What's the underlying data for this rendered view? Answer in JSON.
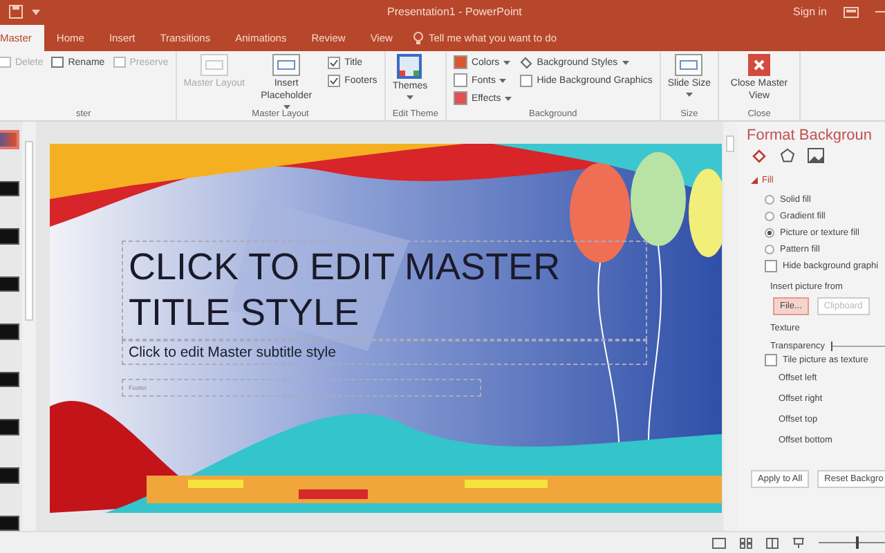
{
  "window": {
    "title": "Presentation1 - PowerPoint",
    "sign_in": "Sign in"
  },
  "tabs": [
    {
      "label": "Master",
      "selected": true
    },
    {
      "label": "Home",
      "selected": false
    },
    {
      "label": "Insert",
      "selected": false
    },
    {
      "label": "Transitions",
      "selected": false
    },
    {
      "label": "Animations",
      "selected": false
    },
    {
      "label": "Review",
      "selected": false
    },
    {
      "label": "View",
      "selected": false
    }
  ],
  "tell_me": {
    "placeholder": "Tell me what you want to do"
  },
  "ribbon": {
    "groups": [
      {
        "label": "ster",
        "items": [
          {
            "kind": "small",
            "label": "Delete",
            "disabled": true
          },
          {
            "kind": "small",
            "label": "Rename",
            "disabled": false
          },
          {
            "kind": "small",
            "label": "Preserve",
            "disabled": true
          }
        ]
      },
      {
        "label": "Master Layout",
        "items": [
          {
            "kind": "large",
            "label": "Master Layout",
            "disabled": true,
            "dropdown": false
          },
          {
            "kind": "large",
            "label": "Insert Placeholder",
            "disabled": false,
            "dropdown": true
          },
          {
            "kind": "checks",
            "checks": [
              {
                "label": "Title",
                "checked": true
              },
              {
                "label": "Footers",
                "checked": true
              }
            ]
          }
        ]
      },
      {
        "label": "Edit Theme",
        "items": [
          {
            "kind": "large",
            "label": "Themes",
            "disabled": false,
            "dropdown": true
          }
        ]
      },
      {
        "label": "Background",
        "items": [
          {
            "kind": "menus",
            "menus": [
              {
                "label": "Colors"
              },
              {
                "label": "Fonts"
              },
              {
                "label": "Effects"
              }
            ]
          },
          {
            "kind": "bg",
            "style": "Background Styles",
            "hide": {
              "label": "Hide Background Graphics",
              "checked": false
            }
          }
        ]
      },
      {
        "label": "Size",
        "items": [
          {
            "kind": "large",
            "label": "Slide Size",
            "disabled": false,
            "dropdown": true
          }
        ]
      },
      {
        "label": "Close",
        "items": [
          {
            "kind": "large",
            "label": "Close Master View",
            "disabled": false,
            "dropdown": false
          }
        ]
      }
    ]
  },
  "thumbnails": [
    {
      "selected": true
    },
    {
      "selected": false
    },
    {
      "selected": false
    },
    {
      "selected": false
    },
    {
      "selected": false
    },
    {
      "selected": false
    },
    {
      "selected": false
    },
    {
      "selected": false
    },
    {
      "selected": false
    }
  ],
  "slide": {
    "title": "CLICK TO EDIT MASTER TITLE STYLE",
    "subtitle": "Click to edit Master subtitle style",
    "footer": "Footer"
  },
  "pane": {
    "title": "Format Backgroun",
    "section": {
      "label": "Fill",
      "expanded": true
    },
    "fills": [
      {
        "label": "Solid fill",
        "selected": false
      },
      {
        "label": "Gradient fill",
        "selected": false
      },
      {
        "label": "Picture or texture fill",
        "selected": true
      },
      {
        "label": "Pattern fill",
        "selected": false
      }
    ],
    "hide_graphics": {
      "label": "Hide background graphi",
      "checked": false
    },
    "insert_from": "Insert picture from",
    "source_buttons": [
      {
        "label": "File...",
        "disabled": false
      },
      {
        "label": "Clipboard",
        "disabled": true
      }
    ],
    "texture": "Texture",
    "transparency": {
      "label": "Transparency",
      "level": 0.02
    },
    "tile": {
      "label": "Tile picture as texture",
      "checked": false
    },
    "offsets": [
      "Offset left",
      "Offset right",
      "Offset top",
      "Offset bottom"
    ],
    "buttons": [
      "Apply to All",
      "Reset Backgro"
    ]
  },
  "status": {
    "zoom": {
      "level": 0.45
    }
  }
}
